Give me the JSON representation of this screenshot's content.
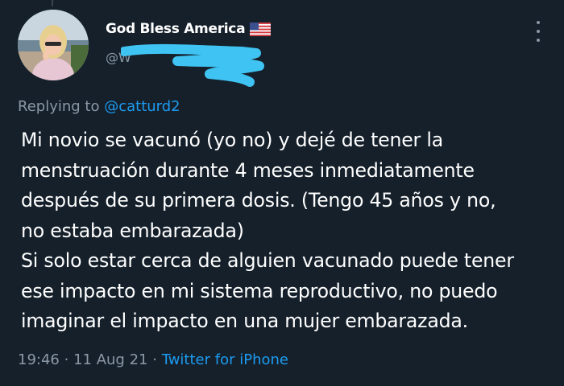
{
  "tweet": {
    "display_name": "God Bless America",
    "display_name_emoji": "flag-us-icon",
    "handle": "@W",
    "replying_prefix": "Replying to",
    "replying_to": "@catturd2",
    "text": "Mi novio se vacunó (yo no) y dejé de tener la\nmenstruación durante 4 meses inmediatamente\ndespués de su primera dosis. (Tengo 45 años y no,\nno estaba embarazada)\nSi solo estar cerca de alguien vacunado puede tener\nese impacto en mi sistema reproductivo, no puedo\nimaginar el impacto en una mujer embarazada.",
    "time": "19:46",
    "separator": "·",
    "date": "11 Aug 21",
    "source": "Twitter for iPhone"
  },
  "colors": {
    "background": "#15202b",
    "text": "#ffffff",
    "muted": "#8b98a5",
    "accent": "#1d9bf0",
    "redaction": "#3fc3f2"
  }
}
